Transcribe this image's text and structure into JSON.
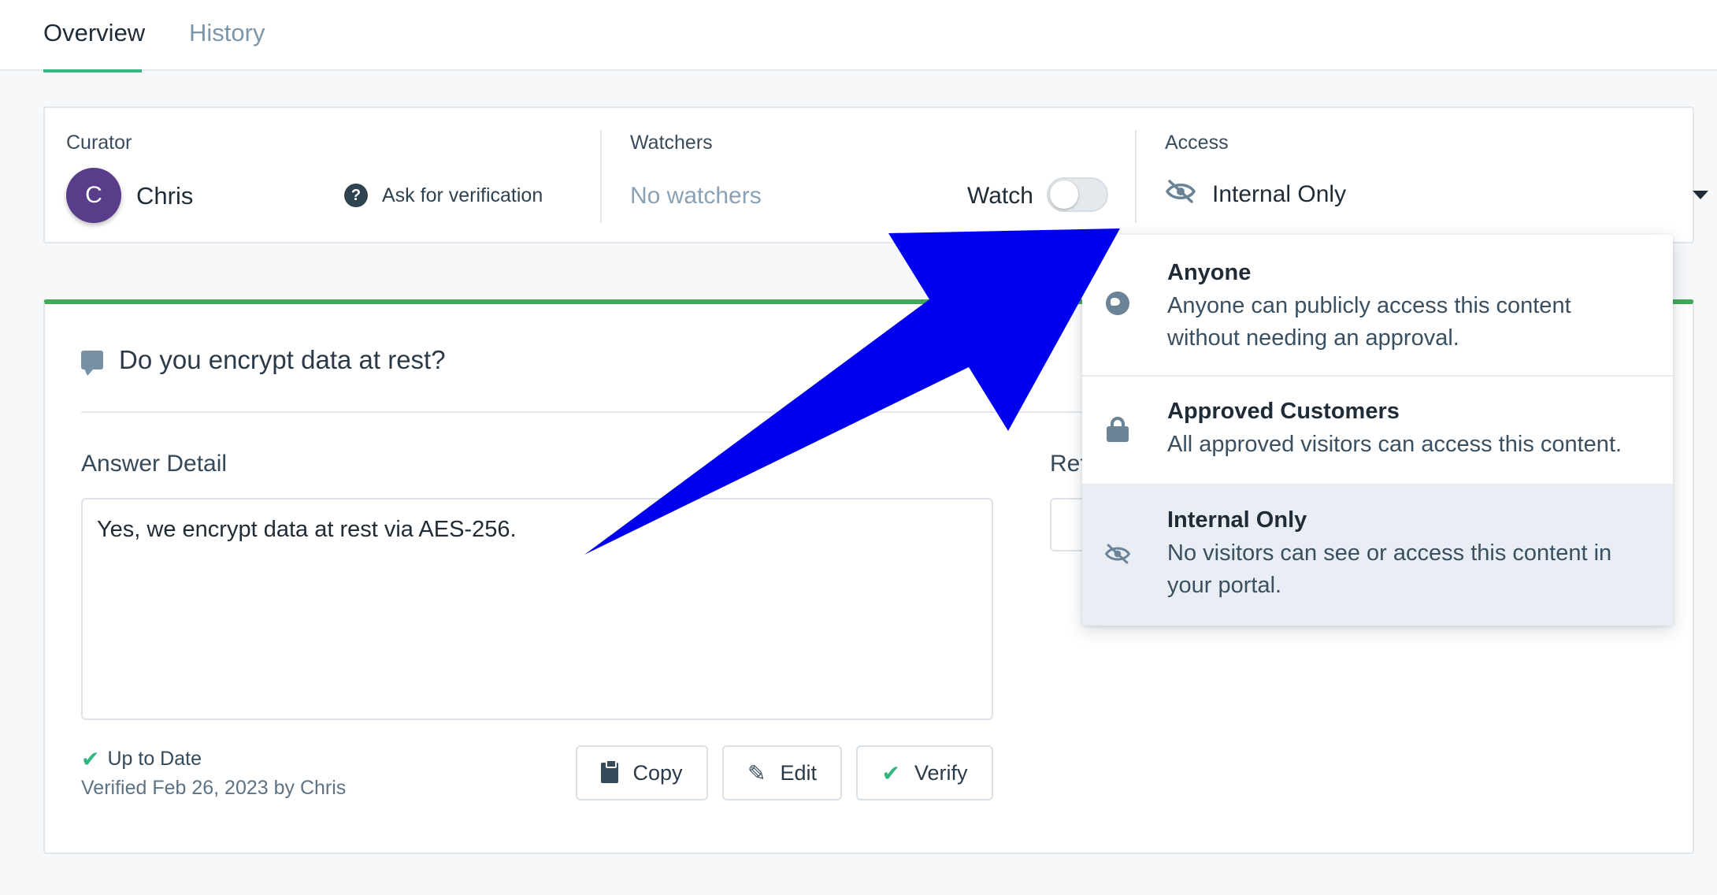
{
  "tabs": {
    "overview": "Overview",
    "history": "History"
  },
  "curator": {
    "label": "Curator",
    "avatar_initial": "C",
    "name": "Chris",
    "ask_verification": "Ask for verification"
  },
  "watchers": {
    "label": "Watchers",
    "status": "No watchers",
    "watch_label": "Watch",
    "watch_on": false
  },
  "access": {
    "label": "Access",
    "value": "Internal Only"
  },
  "question": {
    "title": "Do you encrypt data at rest?",
    "answer_label": "Answer Detail",
    "reference_label": "Ref",
    "answer_text": "Yes, we encrypt data at rest via AES-256.",
    "status": "Up to Date",
    "verified_by": "Verified Feb 26, 2023 by Chris"
  },
  "buttons": {
    "copy": "Copy",
    "edit": "Edit",
    "verify": "Verify"
  },
  "access_options": [
    {
      "title": "Anyone",
      "desc": "Anyone can publicly access this content without needing an approval.",
      "icon": "globe-icon"
    },
    {
      "title": "Approved Customers",
      "desc": "All approved visitors can access this content.",
      "icon": "lock-icon"
    },
    {
      "title": "Internal Only",
      "desc": "No visitors can see or access this content in your portal.",
      "icon": "eye-slash-icon",
      "selected": true
    }
  ],
  "colors": {
    "accent_green": "#39b885",
    "card_top_border": "#43a85a",
    "avatar_bg": "#5a3d8a",
    "annotation_arrow": "#0000ee",
    "selected_option_bg": "#e8eef3"
  }
}
